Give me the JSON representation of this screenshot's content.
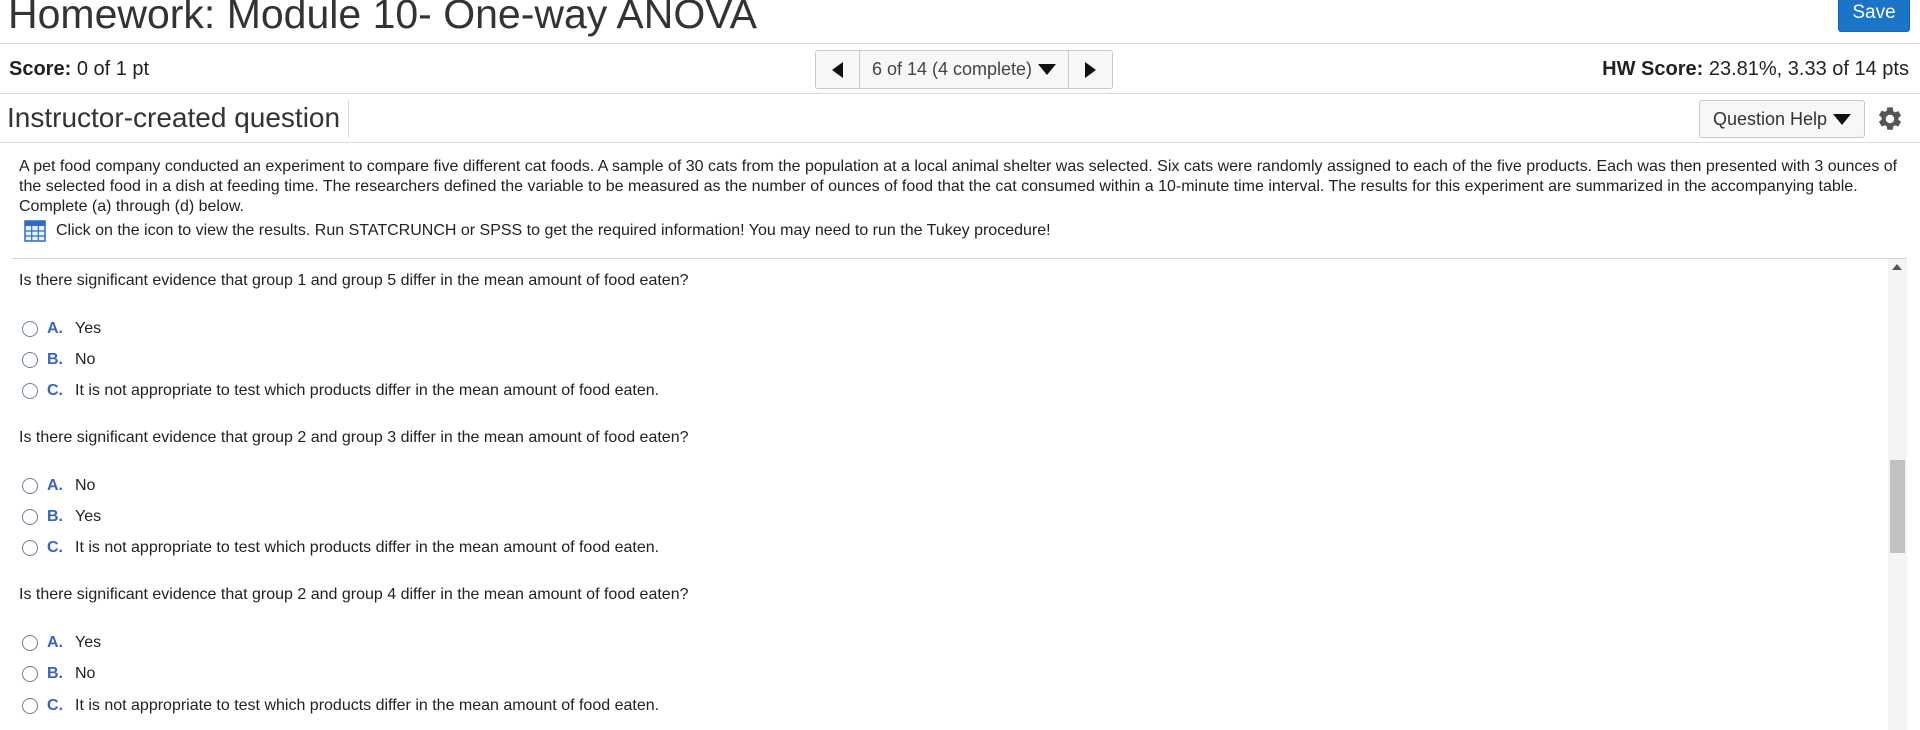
{
  "header": {
    "title": "Homework: Module 10- One-way ANOVA",
    "save_label": "Save"
  },
  "score_bar": {
    "score_label": "Score:",
    "score_value": "0 of 1 pt",
    "nav_position": "6 of 14 (4 complete)",
    "hw_score_label": "HW Score:",
    "hw_score_value": "23.81%, 3.33 of 14 pts"
  },
  "question_header": {
    "title": "Instructor-created question",
    "help_label": "Question Help"
  },
  "problem": {
    "text": "A pet food company conducted an experiment to compare five different cat foods. A sample of 30 cats from the population at a local animal shelter was selected. Six cats were randomly assigned to each of the five products. Each was then presented with 3 ounces of the selected food in a dish at feeding time. The researchers defined the variable to be measured as the number of ounces of food that the cat consumed within a 10-minute time interval. The results for this experiment are summarized in the accompanying table. Complete (a) through (d) below.",
    "click_text": "Click on the icon to view the results.  Run STATCRUNCH or SPSS to get the required information!  You may need to run the Tukey procedure!"
  },
  "questions": [
    {
      "text": "Is there significant evidence that group 1 and group 5 differ in the mean amount of food eaten?",
      "options": [
        {
          "letter": "A.",
          "text": "Yes"
        },
        {
          "letter": "B.",
          "text": "No"
        },
        {
          "letter": "C.",
          "text": "It is not appropriate to test which products differ in the mean amount of food eaten."
        }
      ]
    },
    {
      "text": "Is there significant evidence that group 2 and group 3 differ in the mean amount of food eaten?",
      "options": [
        {
          "letter": "A.",
          "text": "No"
        },
        {
          "letter": "B.",
          "text": "Yes"
        },
        {
          "letter": "C.",
          "text": "It is not appropriate to test which products differ in the mean amount of food eaten."
        }
      ]
    },
    {
      "text": "Is there significant evidence that group 2 and group 4 differ in the mean amount of food eaten?",
      "options": [
        {
          "letter": "A.",
          "text": "Yes"
        },
        {
          "letter": "B.",
          "text": "No"
        },
        {
          "letter": "C.",
          "text": "It is not appropriate to test which products differ in the mean amount of food eaten."
        }
      ]
    }
  ]
}
